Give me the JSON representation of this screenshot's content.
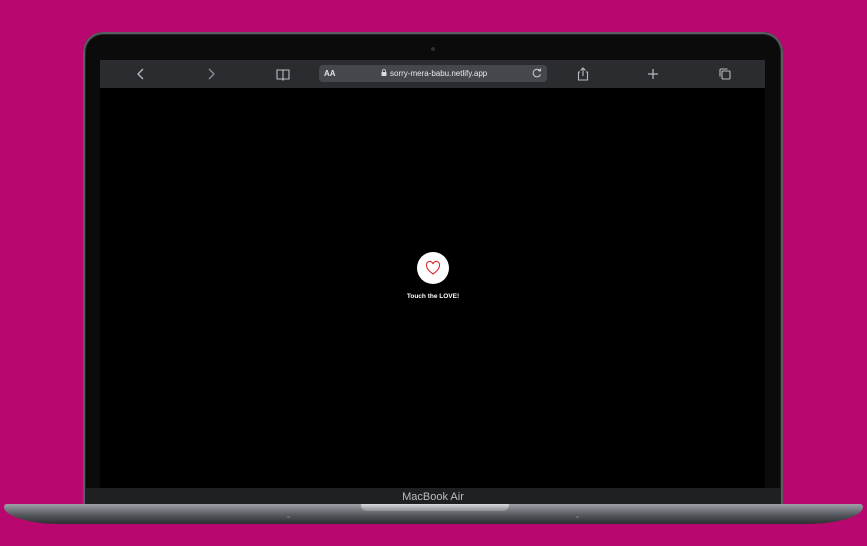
{
  "browser": {
    "text_size_label": "AA",
    "url": "sorry-mera-babu.netlify.app",
    "toolbar_icons": [
      "back-icon",
      "forward-icon",
      "bookmarks-icon",
      "share-icon",
      "new-tab-icon",
      "tabs-icon",
      "reload-icon",
      "lock-icon"
    ]
  },
  "page": {
    "cta_text": "Touch the LOVE!",
    "accent_color": "#e0242b"
  },
  "device": {
    "label": "MacBook Air",
    "background_color": "#b8086f"
  }
}
